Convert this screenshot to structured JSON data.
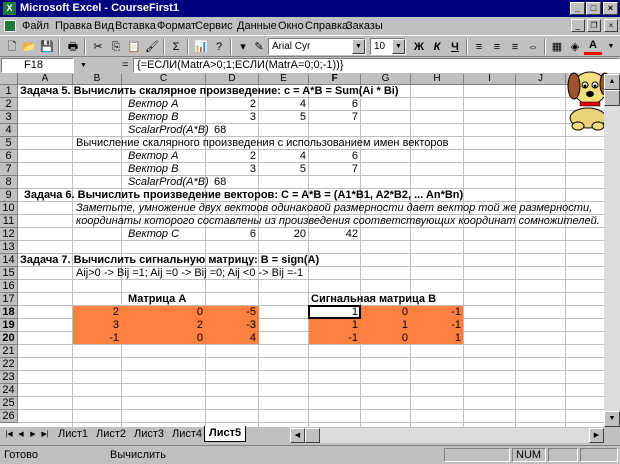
{
  "window": {
    "title": "Microsoft Excel - CourseFirst1",
    "app_icon": "excel-icon"
  },
  "menu": [
    "Файл",
    "Правка",
    "Вид",
    "Вставка",
    "Формат",
    "Сервис",
    "Данные",
    "Окно",
    "Справка",
    "Заказы"
  ],
  "toolbar": {
    "font_name": "Arial Cyr",
    "font_size": "10",
    "bold": "Ж",
    "italic": "К",
    "underline": "Ч",
    "sum": "Σ",
    "percent": "%",
    "thousands": "000",
    "fill_color": "#ffff00",
    "font_color": "#ff0000"
  },
  "formula_bar": {
    "name_box": "F18",
    "equals": "=",
    "formula": "{=ЕСЛИ(MatrA>0;1;ЕСЛИ(MatrA=0;0;-1))}"
  },
  "columns": [
    "A",
    "B",
    "C",
    "D",
    "E",
    "F",
    "G",
    "H",
    "I",
    "J"
  ],
  "rows": [
    "1",
    "2",
    "3",
    "4",
    "5",
    "6",
    "7",
    "8",
    "9",
    "10",
    "11",
    "12",
    "13",
    "14",
    "15",
    "16",
    "17",
    "18",
    "19",
    "20",
    "21",
    "22",
    "23",
    "24",
    "25",
    "26"
  ],
  "cells": {
    "r1": "Задача 5. Вычислить скалярное произведение: c = A*B = Sum(Ai * Bi)",
    "r2_label": "Вектор A",
    "r2_d": "2",
    "r2_e": "4",
    "r2_f": "6",
    "r3_label": "Вектор B",
    "r3_d": "3",
    "r3_e": "5",
    "r3_f": "7",
    "r4_label": "ScalarProd(A*B)",
    "r4_d": "68",
    "r5": "Вычисление скалярного произведения с использованием имен векторов",
    "r6_label": "Вектор A",
    "r6_d": "2",
    "r6_e": "4",
    "r6_f": "6",
    "r7_label": "Вектор B",
    "r7_d": "3",
    "r7_e": "5",
    "r7_f": "7",
    "r8_label": "ScalarProd(A*B)",
    "r8_d": "68",
    "r9": "Задача 6. Вычислить  произведение векторов: C = A*B = (A1*B1, A2*B2, ... An*Bn)",
    "r10": "Заметьте, умножение двух вектоов одинаковой размерности дает вектор той же размерности,",
    "r11": "координаты которого составлены из произведения соответствующих координат сомножителей.",
    "r12_label": "Вектор C",
    "r12_d": "6",
    "r12_e": "20",
    "r12_f": "42",
    "r14": "Задача 7. Вычислить сигнальную матрицу: B = sign(A)",
    "r15": "Aij>0 -> Bij =1;  Aij =0 -> Bij =0;  Aij <0 -> Bij =-1",
    "r17_a": "Матрица A",
    "r17_b": "Сигнальная матрица B",
    "matrix_a": [
      [
        "2",
        "0",
        "-5"
      ],
      [
        "3",
        "2",
        "-3"
      ],
      [
        "-1",
        "0",
        "4"
      ]
    ],
    "matrix_b": [
      [
        "1",
        "0",
        "-1"
      ],
      [
        "1",
        "1",
        "-1"
      ],
      [
        "-1",
        "0",
        "1"
      ]
    ],
    "highlight_color": "#ff8040"
  },
  "sheets": [
    "Лист1",
    "Лист2",
    "Лист3",
    "Лист4",
    "Лист5"
  ],
  "active_sheet": "Лист5",
  "status": {
    "ready": "Готово",
    "mode": "Вычислить",
    "num": "NUM"
  }
}
